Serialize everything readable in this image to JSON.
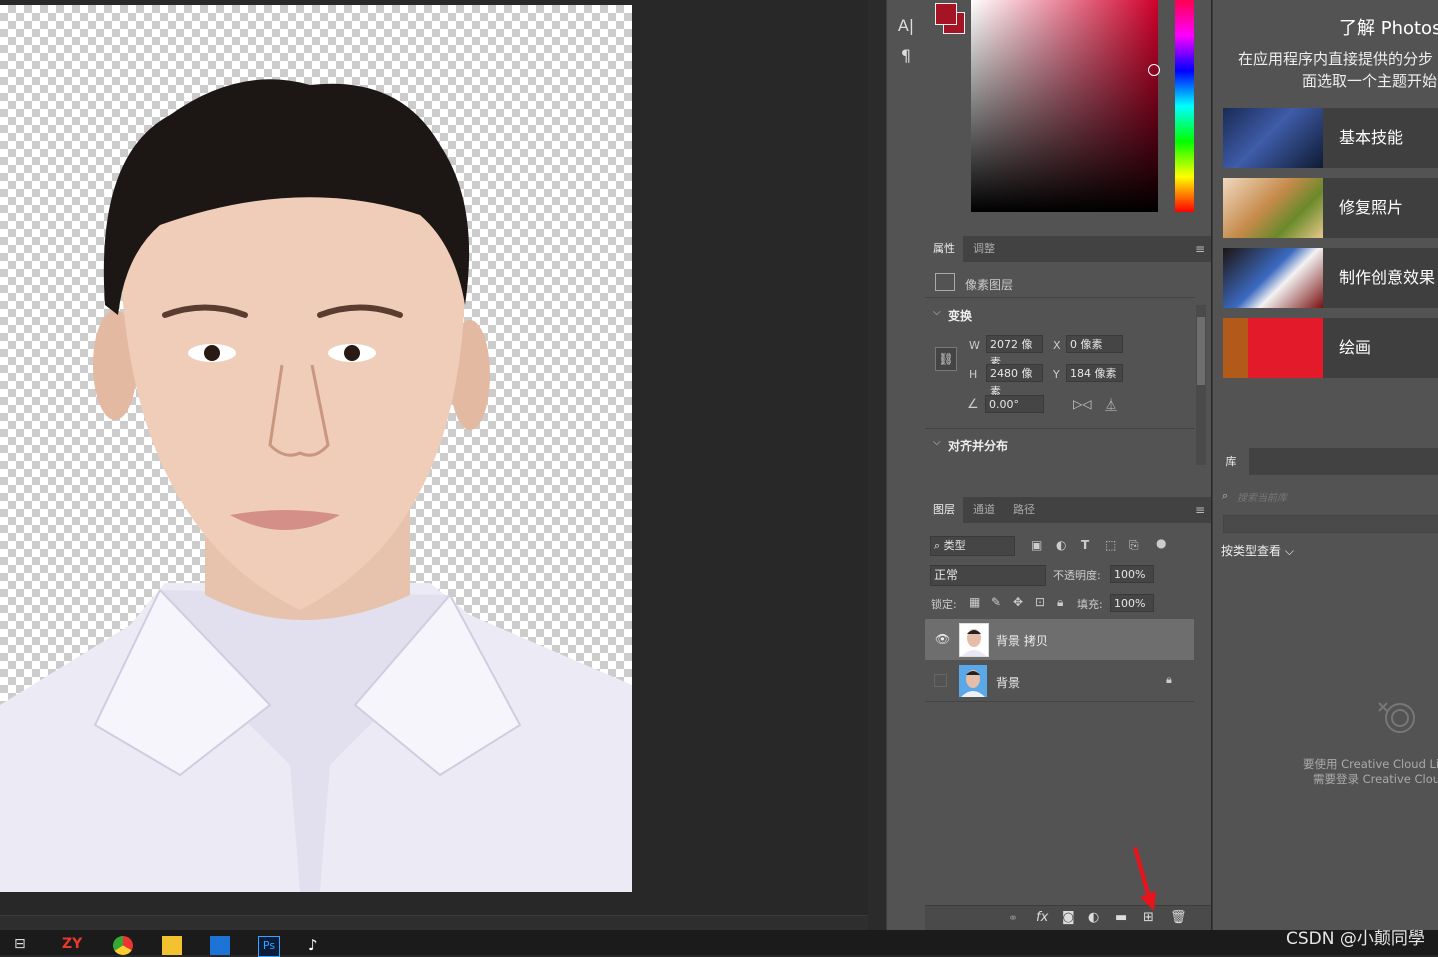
{
  "colors": {
    "foreground": "#a41424",
    "background": "#a41424",
    "hue_base": "#d0002a",
    "panel_bg": "#535353",
    "canvas_bg": "#282828",
    "arrow": "#e8141c"
  },
  "tools": {
    "type_icon": "A|",
    "paragraph_icon": "¶"
  },
  "properties_panel": {
    "tabs": [
      {
        "label": "属性"
      },
      {
        "label": "调整"
      }
    ],
    "layer_type": "像素图层",
    "transform": {
      "header": "变换",
      "w_label": "W",
      "w_value": "2072 像素",
      "x_label": "X",
      "x_value": "0 像素",
      "h_label": "H",
      "h_value": "2480 像素",
      "y_label": "Y",
      "y_value": "184 像素",
      "angle_value": "0.00°"
    },
    "align_header": "对齐并分布"
  },
  "layers_panel": {
    "tabs": [
      {
        "label": "图层"
      },
      {
        "label": "通道"
      },
      {
        "label": "路径"
      }
    ],
    "filter_label": "类型",
    "blend_mode": "正常",
    "opacity_label": "不透明度:",
    "opacity_value": "100%",
    "lock_label": "锁定:",
    "fill_label": "填充:",
    "fill_value": "100%",
    "layers": [
      {
        "name": "背景 拷贝",
        "visible": true,
        "selected": true,
        "locked": false
      },
      {
        "name": "背景",
        "visible": false,
        "selected": false,
        "locked": true
      }
    ],
    "bottom_icons": [
      "link-icon",
      "fx-icon",
      "mask-icon",
      "adjustment-icon",
      "folder-icon",
      "new-layer-icon",
      "trash-icon"
    ]
  },
  "learn_panel": {
    "title": "了解 Photosh",
    "subtitle_line1": "在应用程序内直接提供的分步",
    "subtitle_line2": "面选取一个主题开始",
    "topics": [
      {
        "label": "基本技能"
      },
      {
        "label": "修复照片"
      },
      {
        "label": "制作创意效果"
      },
      {
        "label": "绘画"
      }
    ]
  },
  "library_panel": {
    "tab": "库",
    "search_placeholder": "搜索当前库",
    "view_by": "按类型查看",
    "message_line1": "要使用 Creative Cloud Lib",
    "message_line2": "需要登录 Creative Clou"
  },
  "watermark": "CSDN @小颠同學",
  "taskbar": {
    "zy_label": "ZY",
    "ps_label": "Ps"
  }
}
